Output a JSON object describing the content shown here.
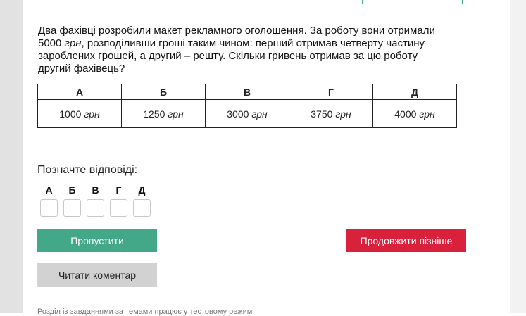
{
  "question": {
    "text_part1": "Два фахівці розробили макет рекламного оголошення. За роботу вони отримали 5000 ",
    "unit": "грн",
    "text_part2": ", розподіливши гроші таким чином: перший отримав четверту частину заро­блених грошей, а другий – решту. Скільки гривень отримав за цю роботу другий фахівець?"
  },
  "options": [
    {
      "letter": "А",
      "value": "1000",
      "unit": "грн"
    },
    {
      "letter": "Б",
      "value": "1250",
      "unit": "грн"
    },
    {
      "letter": "В",
      "value": "3000",
      "unit": "грн"
    },
    {
      "letter": "Г",
      "value": "3750",
      "unit": "грн"
    },
    {
      "letter": "Д",
      "value": "4000",
      "unit": "грн"
    }
  ],
  "answer_prompt": "Позначте відповіді:",
  "answer_letters": [
    "А",
    "Б",
    "В",
    "Г",
    "Д"
  ],
  "buttons": {
    "skip": "Пропустити",
    "later": "Продовжити пізніше",
    "comment": "Читати коментар"
  },
  "footer": "Розділ із завданнями за темами працює у тестовому режимі",
  "colors": {
    "skip": "#42a887",
    "later": "#d9213c",
    "comment": "#d2d2d2"
  }
}
